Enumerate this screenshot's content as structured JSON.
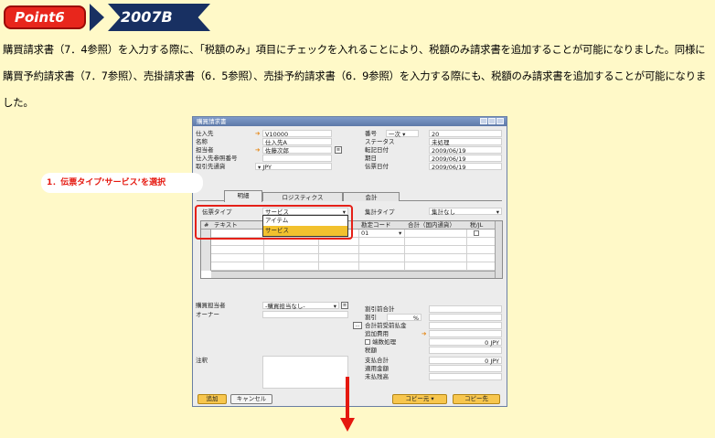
{
  "header": {
    "point_label": "Point6",
    "version_label": "2007B"
  },
  "description": "購買請求書（7．4参照）を入力する際に、「税額のみ」項目にチェックを入れることにより、税額のみ請求書を追加することが可能になりました。同様に購買予約請求書（7．7参照）、売掛請求書（6．5参照）、売掛予約請求書（6．9参照）を入力する際にも、税額のみ請求書を追加することが可能になりました。",
  "window": {
    "title": "購買請求書",
    "left_fields": [
      {
        "label": "仕入先",
        "value": "V10000"
      },
      {
        "label": "名称",
        "value": "仕入先A"
      },
      {
        "label": "担当者",
        "value": "佐藤次郎"
      },
      {
        "label": "仕入先参照番号",
        "value": ""
      },
      {
        "label": "取引先通貨",
        "value": "JPY"
      }
    ],
    "right_fields": [
      {
        "label": "番号",
        "series": "一次",
        "value": "20"
      },
      {
        "label": "ステータス",
        "value": "未処理"
      },
      {
        "label": "転記日付",
        "value": "2009/06/19"
      },
      {
        "label": "期日",
        "value": "2009/06/19"
      },
      {
        "label": "伝票日付",
        "value": "2009/06/19"
      }
    ],
    "tabs": [
      "明細",
      "ロジスティクス",
      "会計"
    ],
    "doc_type_label": "伝票タイプ",
    "doc_type_value": "サービス",
    "summary_type_label": "集計タイプ",
    "summary_type_value": "集計なし",
    "grid_columns": [
      "#",
      "テキスト",
      "勘定コード",
      "合計（国内通貨）",
      "税/JL"
    ],
    "grid_first_row_code": "01",
    "dropdown_options": [
      "アイテム",
      "サービス"
    ],
    "lower_left": [
      {
        "label": "購買担当者",
        "value": "-購買担当なし-"
      },
      {
        "label": "オーナー",
        "value": ""
      },
      {
        "label": "注釈",
        "value": ""
      }
    ],
    "totals": [
      {
        "label": "割引前合計",
        "value": ""
      },
      {
        "label": "割引",
        "value": "",
        "unit": "%"
      },
      {
        "label": "合計前受前払金",
        "value": ""
      },
      {
        "label": "追加費用",
        "value": ""
      },
      {
        "label": "端数処理",
        "value": "0 JPY"
      },
      {
        "label": "税額",
        "value": ""
      },
      {
        "label": "支払合計",
        "value": "0 JPY"
      },
      {
        "label": "適用金額",
        "value": ""
      },
      {
        "label": "未払残高",
        "value": ""
      }
    ],
    "buttons": {
      "add": "追加",
      "cancel": "キャンセル",
      "copy_from": "コピー元",
      "copy_to": "コピー先"
    }
  },
  "callout": "1．伝票タイプ’サービス’を選択",
  "colors": {
    "accent_red": "#e5180f",
    "navy": "#183062",
    "page_bg": "#fff9c8",
    "highlight": "#f2c12e"
  }
}
